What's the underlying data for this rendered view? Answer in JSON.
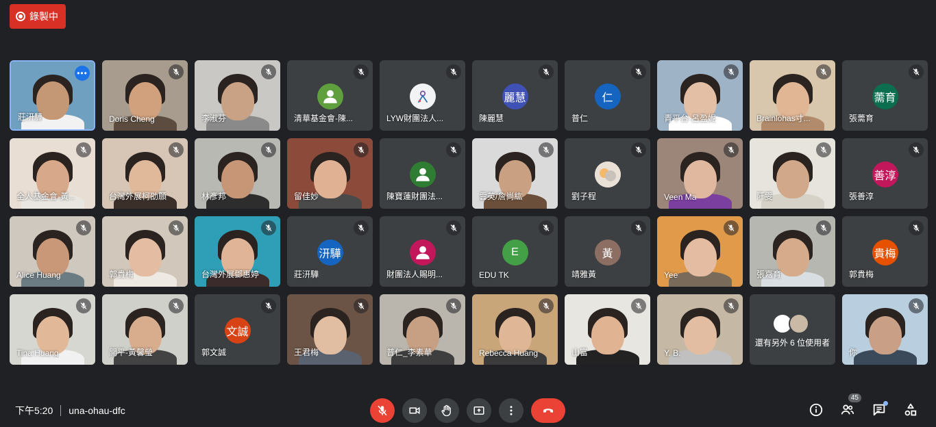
{
  "recording": {
    "label": "錄製中"
  },
  "tiles": [
    {
      "name": "莊汧驊",
      "kind": "video",
      "bg": "#6fa0c0",
      "skin": "#c49775",
      "shirt": "#f2f2f2",
      "active": true,
      "more": true
    },
    {
      "name": "Doris Cheng",
      "kind": "video",
      "bg": "#a89c8e",
      "skin": "#d1a07c",
      "shirt": "#5b4c3f"
    },
    {
      "name": "李淑芬",
      "kind": "video",
      "bg": "#c9c8c4",
      "skin": "#c9a184",
      "shirt": "#8a8a8a"
    },
    {
      "name": "清華基金會-陳...",
      "kind": "avatar",
      "avatar_type": "generic",
      "color": "#5f9f3e"
    },
    {
      "name": "LYW財團法人...",
      "kind": "avatar",
      "avatar_type": "logo",
      "color": "#f1f3f4"
    },
    {
      "name": "陳麗慧",
      "kind": "avatar",
      "initials": "麗慧",
      "color": "#3f51b5"
    },
    {
      "name": "普仁",
      "kind": "avatar",
      "initials": "仁",
      "color": "#1565c0"
    },
    {
      "name": "青平台-呂盈妮",
      "kind": "video",
      "bg": "#9fb3c7",
      "skin": "#e3bfa6",
      "shirt": "#ffffff"
    },
    {
      "name": "Brainlohas寸...",
      "kind": "video",
      "bg": "#d9c7ad",
      "skin": "#e0b694",
      "shirt": "#b18b6c"
    },
    {
      "name": "張薷育",
      "kind": "avatar",
      "initials": "薷育",
      "color": "#0b6e4f"
    },
    {
      "name": "全人基金會-黃...",
      "kind": "video",
      "bg": "#e8ded4",
      "skin": "#d7a889",
      "shirt": "#e9e6e1"
    },
    {
      "name": "台灣外展柯劭願",
      "kind": "video",
      "bg": "#d7c6b5",
      "skin": "#e0b89a",
      "shirt": "#3b2f2a"
    },
    {
      "name": "林彥邦",
      "kind": "video",
      "bg": "#b9b9b3",
      "skin": "#c69676",
      "shirt": "#2d2d2d"
    },
    {
      "name": "留佳妙",
      "kind": "video",
      "bg": "#8c4a3a",
      "skin": "#e0b293",
      "shirt": "#4a4a4a"
    },
    {
      "name": "陳寶蓮財團法...",
      "kind": "avatar",
      "avatar_type": "generic",
      "color": "#2e7d32"
    },
    {
      "name": "雲英/詹尚紘",
      "kind": "video",
      "bg": "#dadada",
      "skin": "#caa083",
      "shirt": "#6b4f3a"
    },
    {
      "name": "劉子程",
      "kind": "avatar",
      "avatar_type": "photo",
      "color": "#d6ccbf"
    },
    {
      "name": "Veen Ma",
      "kind": "video",
      "bg": "#9c8579",
      "skin": "#e0b8a0",
      "shirt": "#7b3fa0"
    },
    {
      "name": "阡雯",
      "kind": "video",
      "bg": "#e6e4dc",
      "skin": "#d1a98a",
      "shirt": "#d6d2c8"
    },
    {
      "name": "張善淳",
      "kind": "avatar",
      "initials": "善淳",
      "color": "#c2185b"
    },
    {
      "name": "Alice Huang",
      "kind": "video",
      "bg": "#cfc8be",
      "skin": "#c99878",
      "shirt": "#6c7c83"
    },
    {
      "name": "郭貴梅",
      "kind": "video",
      "bg": "#d1c7bb",
      "skin": "#e3bca2",
      "shirt": "#efe9e3"
    },
    {
      "name": "台灣外展鄧惠婷",
      "kind": "video",
      "bg": "#2f9fb8",
      "skin": "#e0b496",
      "shirt": "#3b2b2b"
    },
    {
      "name": "莊汧驊",
      "kind": "avatar",
      "initials": "汧驊",
      "color": "#1565c0"
    },
    {
      "name": "財團法人賜明...",
      "kind": "avatar",
      "avatar_type": "generic",
      "color": "#c2185b"
    },
    {
      "name": "EDU TK",
      "kind": "avatar",
      "initials": "E",
      "color": "#43a047"
    },
    {
      "name": "靖雅黃",
      "kind": "avatar",
      "initials": "黃",
      "color": "#8d6e63"
    },
    {
      "name": "Yee",
      "kind": "video",
      "bg": "#e09a4a",
      "skin": "#e3bca2",
      "shirt": "#7a6a5a"
    },
    {
      "name": "張嘉育",
      "kind": "video",
      "bg": "#b7b7b2",
      "skin": "#d6ab8b",
      "shirt": "#d9dee3"
    },
    {
      "name": "郭貴梅",
      "kind": "avatar",
      "initials": "貴梅",
      "color": "#e65100"
    },
    {
      "name": "Tina Huang",
      "kind": "video",
      "bg": "#d7d7d2",
      "skin": "#e2b998",
      "shirt": "#f1f1f1"
    },
    {
      "name": "開平-黃馨瑩",
      "kind": "video",
      "bg": "#cfd0c9",
      "skin": "#d8ad8d",
      "shirt": "#434343"
    },
    {
      "name": "郭文誠",
      "kind": "avatar",
      "initials": "文誠",
      "color": "#d84315"
    },
    {
      "name": "王君梅",
      "kind": "video",
      "bg": "#6b5346",
      "skin": "#e1bda1",
      "shirt": "#5a6270"
    },
    {
      "name": "普仁_李素華",
      "kind": "video",
      "bg": "#bab6ae",
      "skin": "#c7a084",
      "shirt": "#3e3e3e"
    },
    {
      "name": "Rebecca Huang",
      "kind": "video",
      "bg": "#c9a57a",
      "skin": "#dfb796",
      "shirt": "#3b3b3b"
    },
    {
      "name": "山富",
      "kind": "video",
      "bg": "#e8e6e1",
      "skin": "#e0b393",
      "shirt": "#222222"
    },
    {
      "name": "Y. B.",
      "kind": "video",
      "bg": "#c5b8a5",
      "skin": "#e2bda1",
      "shirt": "#c0c0c0"
    },
    {
      "name": "還有另外 6 位使用者",
      "kind": "others"
    },
    {
      "name": "你",
      "kind": "video",
      "bg": "#b9cfe0",
      "skin": "#c9a085",
      "shirt": "#3a4a5a"
    }
  ],
  "footer": {
    "time": "下午5:20",
    "meeting_code": "una-ohau-dfc",
    "participant_count": "45"
  },
  "icons": {
    "mic_off": "mic-off-icon",
    "camera": "videocam-icon",
    "raise_hand": "hand-icon",
    "present": "present-screen-icon",
    "more": "more-vert-icon",
    "leave": "call-end-icon",
    "info": "info-icon",
    "people": "people-icon",
    "chat": "chat-icon",
    "activities": "activities-icon"
  }
}
